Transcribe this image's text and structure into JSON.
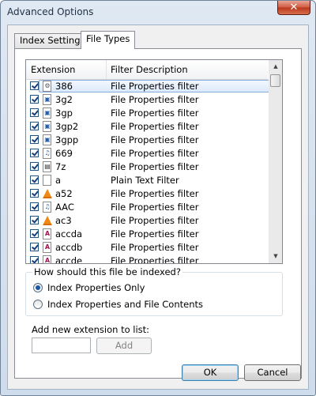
{
  "window": {
    "title": "Advanced Options",
    "close_glyph": "✕"
  },
  "tabs": [
    {
      "label": "Index Settings",
      "active": false
    },
    {
      "label": "File Types",
      "active": true
    }
  ],
  "list": {
    "headers": {
      "extension": "Extension",
      "description": "Filter Description"
    },
    "rows": [
      {
        "ext": "386",
        "desc": "File Properties filter",
        "checked": true,
        "icon": "system-file-icon",
        "selected": true
      },
      {
        "ext": "3g2",
        "desc": "File Properties filter",
        "checked": true,
        "icon": "video-file-icon"
      },
      {
        "ext": "3gp",
        "desc": "File Properties filter",
        "checked": true,
        "icon": "video-file-icon"
      },
      {
        "ext": "3gp2",
        "desc": "File Properties filter",
        "checked": true,
        "icon": "video-file-icon"
      },
      {
        "ext": "3gpp",
        "desc": "File Properties filter",
        "checked": true,
        "icon": "video-file-icon"
      },
      {
        "ext": "669",
        "desc": "File Properties filter",
        "checked": true,
        "icon": "audio-file-icon"
      },
      {
        "ext": "7z",
        "desc": "File Properties filter",
        "checked": true,
        "icon": "archive-file-icon"
      },
      {
        "ext": "a",
        "desc": "Plain Text Filter",
        "checked": true,
        "icon": "blank-file-icon"
      },
      {
        "ext": "a52",
        "desc": "File Properties filter",
        "checked": true,
        "icon": "vlc-cone-icon"
      },
      {
        "ext": "AAC",
        "desc": "File Properties filter",
        "checked": true,
        "icon": "audio-file-icon"
      },
      {
        "ext": "ac3",
        "desc": "File Properties filter",
        "checked": true,
        "icon": "vlc-cone-icon"
      },
      {
        "ext": "accda",
        "desc": "File Properties filter",
        "checked": true,
        "icon": "access-file-icon"
      },
      {
        "ext": "accdb",
        "desc": "File Properties filter",
        "checked": true,
        "icon": "access-file-icon"
      },
      {
        "ext": "accde",
        "desc": "File Properties filter",
        "checked": true,
        "icon": "access-file-icon"
      }
    ],
    "scroll_up_glyph": "▲",
    "scroll_down_glyph": "▼"
  },
  "index_group": {
    "label": "How should this file be indexed?",
    "options": [
      {
        "label": "Index Properties Only",
        "checked": true
      },
      {
        "label": "Index Properties and File Contents",
        "checked": false
      }
    ]
  },
  "add_extension": {
    "label": "Add new extension to list:",
    "value": "",
    "button_label": "Add"
  },
  "buttons": {
    "ok": "OK",
    "cancel": "Cancel"
  },
  "colors": {
    "selection_border": "#84acdd",
    "ok_border": "#3c7fb1",
    "close_red": "#c7472b"
  }
}
